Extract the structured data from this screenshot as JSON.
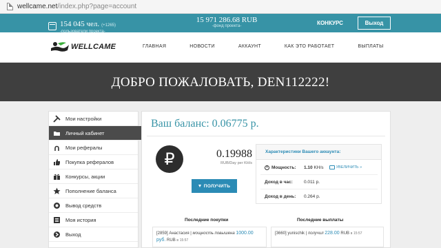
{
  "browser": {
    "url_host": "wellcame.net",
    "url_path": "/index.php?page=account"
  },
  "topbar": {
    "users_count": "154 045 чел.",
    "users_added": "(+1265)",
    "users_label": "-пользователи проекта-",
    "fund_amount": "15 971 286.68 RUB",
    "fund_label": "-фонд проекта-",
    "contest_label": "КОНКУРС",
    "logout_label": "Выход"
  },
  "logo": {
    "text": "WELLCAME"
  },
  "nav": {
    "items": [
      "ГЛАВНАЯ",
      "НОВОСТИ",
      "АККАУНТ",
      "КАК ЭТО РАБОТАЕТ",
      "ВЫПЛАТЫ"
    ]
  },
  "hero": {
    "title": "ДОБРО ПОЖАЛОВАТЬ, DEN112222!"
  },
  "sidebar": {
    "items": [
      {
        "label": "Мои настройки",
        "icon": "tools-icon"
      },
      {
        "label": "Личный кабинет",
        "icon": "folder-icon"
      },
      {
        "label": "Мои рефералы",
        "icon": "horseshoe-icon"
      },
      {
        "label": "Покупка рефералов",
        "icon": "thumbs-up-icon"
      },
      {
        "label": "Конкурсы, акции",
        "icon": "gift-icon"
      },
      {
        "label": "Пополнение баланса",
        "icon": "star-icon"
      },
      {
        "label": "Вывод средств",
        "icon": "coin-icon"
      },
      {
        "label": "Моя история",
        "icon": "list-icon"
      },
      {
        "label": "Выход",
        "icon": "exit-icon"
      }
    ]
  },
  "main": {
    "balance_title": "Ваш баланс: 0.06775 р.",
    "ruble_symbol": "₽",
    "rate_value": "0.19988",
    "rate_unit": "RUB/Day per KH/s",
    "get_button": "ПОЛУЧИТЬ",
    "characteristics": {
      "title": "Характеристики Вашего аккаунта:",
      "power_label": "Мощность:",
      "power_value": "1.10",
      "power_unit": "KH/s",
      "increase_label": "УВЕЛИЧИТЬ »",
      "per_hour_label": "Доход в час:",
      "per_hour_value": "0.011 р.",
      "per_day_label": "Доход в день:",
      "per_day_value": "0.264 р."
    },
    "purchases": {
      "title": "Последние покупки",
      "entry_prefix": "[2859] Анастасия",
      "entry_desc": "мощность повышена",
      "entry_amount": "1000.00",
      "entry_currency": "руб.",
      "entry_rub": "RUB",
      "entry_time_prefix": "в",
      "entry_time": "15:57"
    },
    "payouts": {
      "title": "Последние выплаты",
      "entry_prefix": "[3660] yunischik",
      "entry_desc": "получил",
      "entry_amount": "228.00",
      "entry_rub": "RUB",
      "entry_time_prefix": "в",
      "entry_time": "15:57"
    }
  }
}
